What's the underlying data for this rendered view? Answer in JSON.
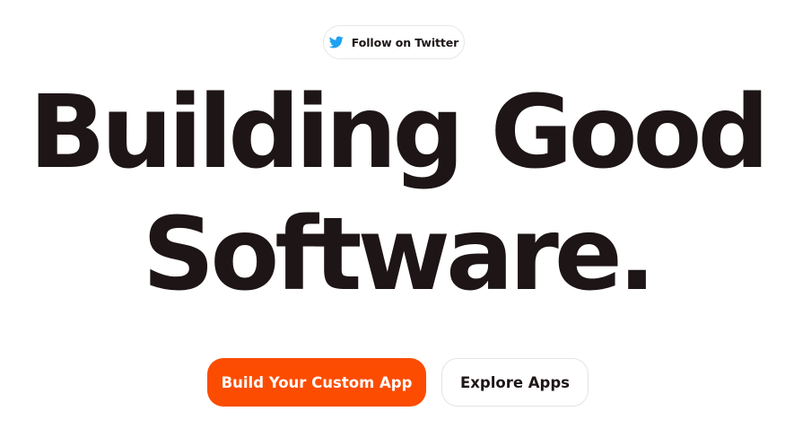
{
  "twitter_button": {
    "label": "Follow on Twitter",
    "icon": "twitter-bird-icon",
    "icon_color": "#1da1f2"
  },
  "hero": {
    "line1": "Building Good",
    "line2": "Software."
  },
  "cta": {
    "primary_label": "Build Your Custom App",
    "secondary_label": "Explore Apps"
  },
  "colors": {
    "accent": "#fc4c02",
    "text": "#1e1516",
    "background": "#ffffff"
  }
}
